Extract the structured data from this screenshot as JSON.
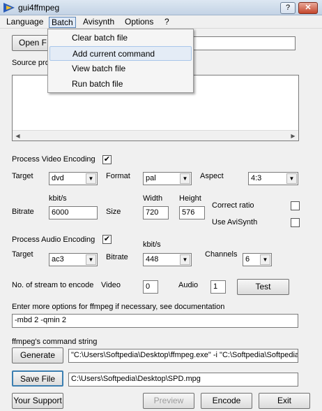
{
  "window": {
    "title": "gui4ffmpeg",
    "help_btn": "?",
    "close_btn": "✕"
  },
  "menu": {
    "language": "Language",
    "batch": "Batch",
    "avisynth": "Avisynth",
    "options": "Options",
    "help": "?"
  },
  "batch_menu": {
    "items": [
      "Clear batch file",
      "Add current command",
      "View batch file",
      "Run batch file"
    ]
  },
  "source": {
    "open_label": "Open F",
    "source_label": "Source pro"
  },
  "video": {
    "process_label": "Process Video Encoding",
    "process_checked": "✔",
    "target_label": "Target",
    "target_value": "dvd",
    "format_label": "Format",
    "format_value": "pal",
    "aspect_label": "Aspect",
    "aspect_value": "4:3",
    "kbits_label": "kbit/s",
    "width_label": "Width",
    "height_label": "Height",
    "bitrate_label": "Bitrate",
    "bitrate_value": "6000",
    "size_label": "Size",
    "width_value": "720",
    "height_value": "576",
    "correct_ratio_label": "Correct ratio",
    "use_avisynth_label": "Use AviSynth"
  },
  "audio": {
    "process_label": "Process Audio Encoding",
    "process_checked": "✔",
    "target_label": "Target",
    "target_value": "ac3",
    "kbits_label": "kbit/s",
    "bitrate_label": "Bitrate",
    "bitrate_value": "448",
    "channels_label": "Channels",
    "channels_value": "6"
  },
  "streams": {
    "label": "No. of stream to encode",
    "video_label": "Video",
    "video_value": "0",
    "audio_label": "Audio",
    "audio_value": "1",
    "test_btn": "Test"
  },
  "options": {
    "label": "Enter more options for ffmpeg if necessary, see documentation",
    "value": "-mbd 2 -qmin 2"
  },
  "command": {
    "label": "ffmpeg's command string",
    "generate_btn": "Generate",
    "value": "\"C:\\Users\\Softpedia\\Desktop\\ffmpeg.exe\" -i \"C:\\Softpedia\\Softpedia"
  },
  "output": {
    "save_btn": "Save File",
    "path": "C:\\Users\\Softpedia\\Desktop\\SPD.mpg"
  },
  "footer": {
    "support_btn": "Your Support",
    "preview_btn": "Preview",
    "encode_btn": "Encode",
    "exit_btn": "Exit"
  }
}
